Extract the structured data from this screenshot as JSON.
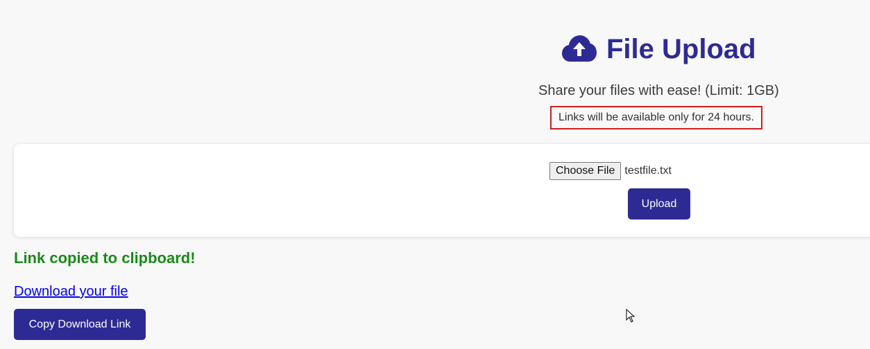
{
  "header": {
    "title": "File Upload",
    "icon": "cloud-upload-icon",
    "subtitle": "Share your files with ease! (Limit: 1GB)",
    "notice": "Links will be available only for 24 hours."
  },
  "upload_form": {
    "choose_file_label": "Choose File",
    "selected_file": "testfile.txt",
    "upload_label": "Upload"
  },
  "result": {
    "status_message": "Link copied to clipboard!",
    "download_link_text": "Download your file",
    "copy_button_label": "Copy Download Link"
  },
  "colors": {
    "brand": "#2e2a94",
    "success": "#1a8a1a",
    "notice_border": "#d01c1c",
    "link": "#0000ee",
    "background": "#f8f8f8"
  }
}
